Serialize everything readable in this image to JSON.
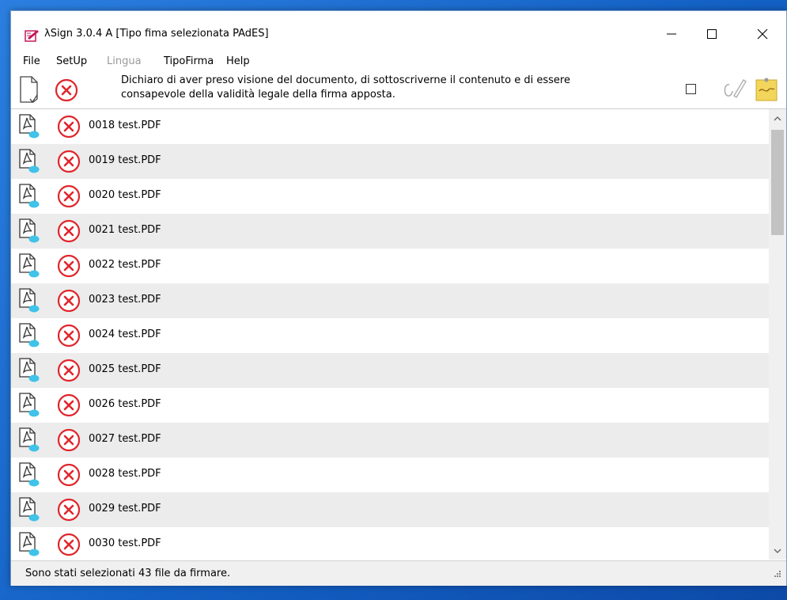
{
  "window": {
    "title": "λSign  3.0.4 A  [Tipo fima selezionata PAdES]"
  },
  "menu": {
    "items": [
      {
        "label": "File",
        "enabled": true
      },
      {
        "label": "SetUp",
        "enabled": true
      },
      {
        "label": "Lingua",
        "enabled": false
      },
      {
        "label": "TipoFirma",
        "enabled": true
      },
      {
        "label": "Help",
        "enabled": true
      }
    ]
  },
  "toolbar": {
    "declaration_line1": "Dichiaro di aver preso visione del documento, di sottoscriverne il contenuto e di essere",
    "declaration_line2": "consapevole della validità legale della firma apposta.",
    "declaration_checked": false,
    "icons": [
      "document-icon",
      "error-icon",
      "checkbox",
      "signature-icon",
      "sticky-note-icon"
    ]
  },
  "files": [
    {
      "name": "0018 test.PDF"
    },
    {
      "name": "0019 test.PDF"
    },
    {
      "name": "0020 test.PDF"
    },
    {
      "name": "0021 test.PDF"
    },
    {
      "name": "0022 test.PDF"
    },
    {
      "name": "0023 test.PDF"
    },
    {
      "name": "0024 test.PDF"
    },
    {
      "name": "0025 test.PDF"
    },
    {
      "name": "0026 test.PDF"
    },
    {
      "name": "0027 test.PDF"
    },
    {
      "name": "0028 test.PDF"
    },
    {
      "name": "0029 test.PDF"
    },
    {
      "name": "0030 test.PDF"
    }
  ],
  "status": {
    "text": "Sono stati selezionati 43 file da firmare."
  },
  "colors": {
    "error_red": "#e0262c",
    "pdf_badge": "#3fc3e8",
    "row_alt": "#ececec",
    "desktop": "#1d6fcf"
  }
}
